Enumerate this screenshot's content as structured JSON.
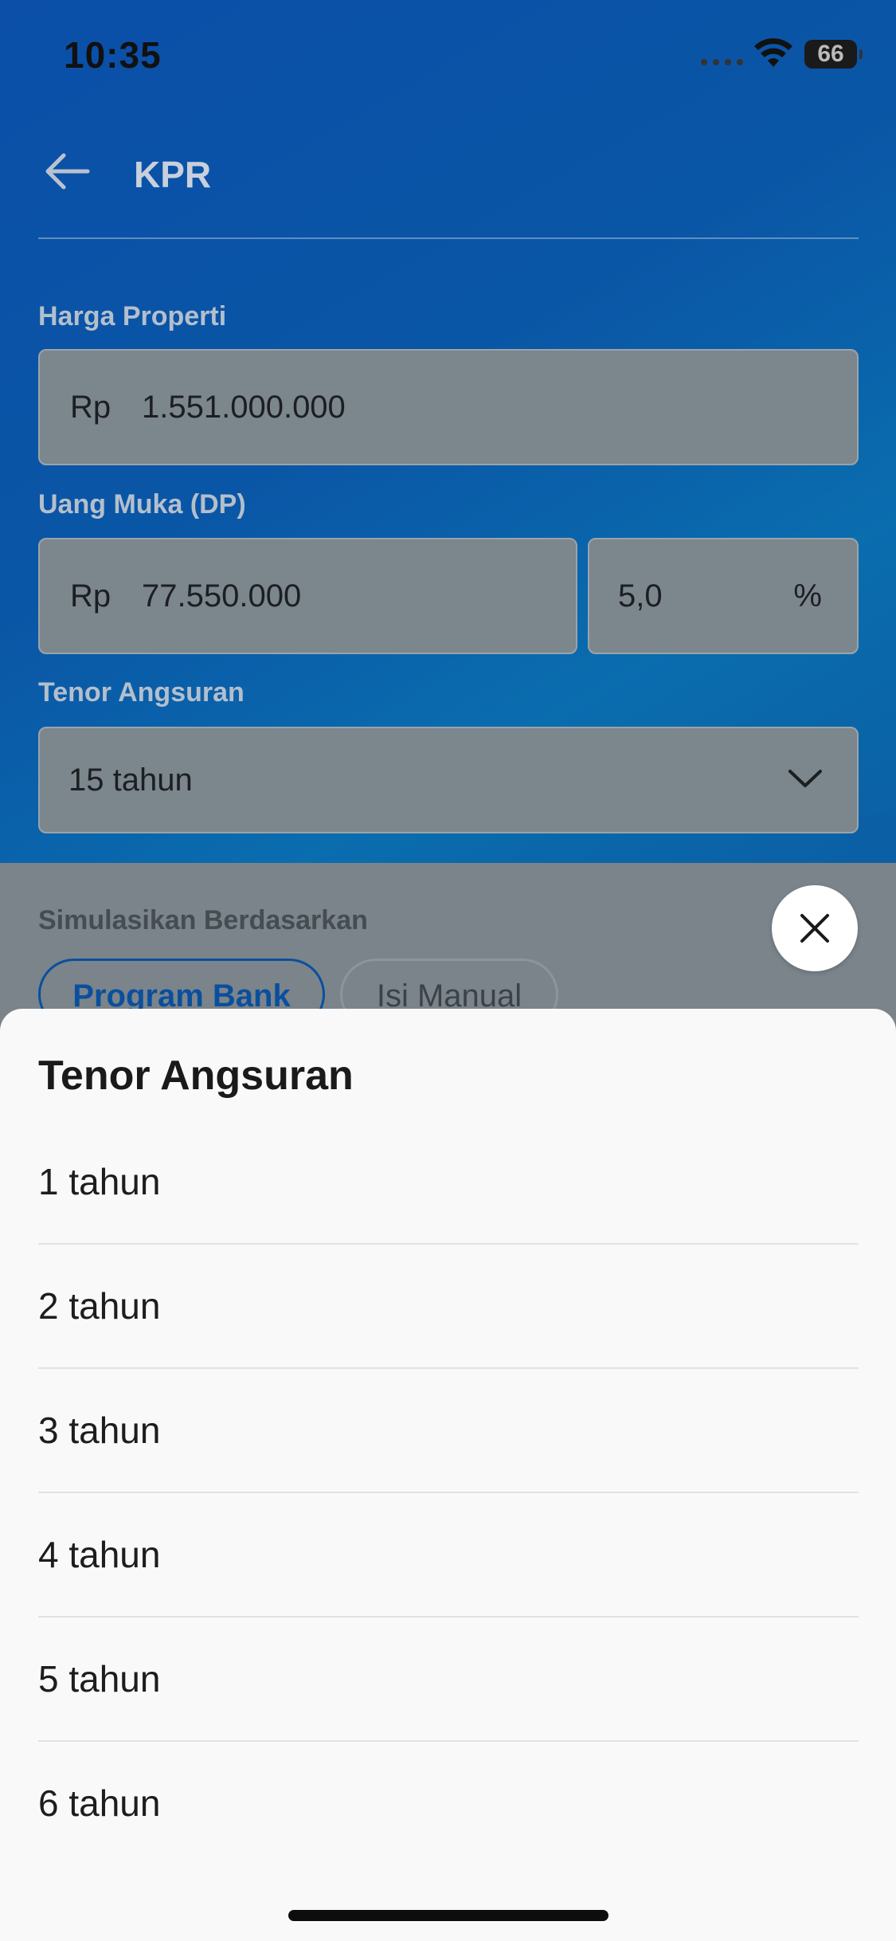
{
  "status_bar": {
    "time": "10:35",
    "battery": "66"
  },
  "header": {
    "title": "KPR"
  },
  "form": {
    "harga_properti": {
      "label": "Harga Properti",
      "prefix": "Rp",
      "value": "1.551.000.000"
    },
    "uang_muka": {
      "label": "Uang Muka (DP)",
      "prefix": "Rp",
      "value": "77.550.000",
      "percent_value": "5,0",
      "percent_unit": "%"
    },
    "tenor": {
      "label": "Tenor Angsuran",
      "value": "15 tahun"
    },
    "simulasi": {
      "label": "Simulasikan Berdasarkan",
      "options": [
        "Program Bank",
        "Isi Manual"
      ]
    }
  },
  "sheet": {
    "title": "Tenor Angsuran",
    "options": [
      "1 tahun",
      "2 tahun",
      "3 tahun",
      "4 tahun",
      "5 tahun",
      "6 tahun"
    ]
  }
}
